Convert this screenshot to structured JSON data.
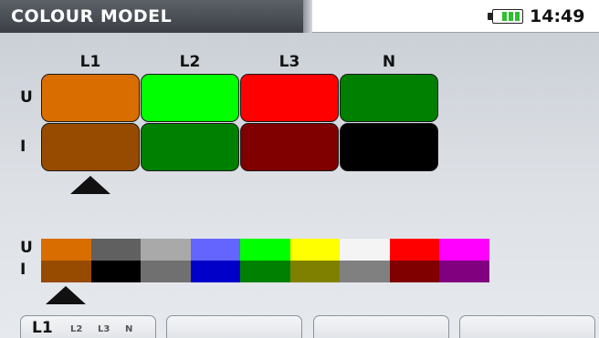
{
  "header": {
    "title": "COLOUR MODEL",
    "time": "14:49",
    "battery_level_fraction": 1.0
  },
  "matrix": {
    "columns": [
      "L1",
      "L2",
      "L3",
      "N"
    ],
    "rows": [
      "U",
      "I"
    ],
    "voltage_colors": [
      "#d96d00",
      "#00ff00",
      "#ff0000",
      "#008000"
    ],
    "current_colors": [
      "#964b00",
      "#008000",
      "#800000",
      "#000000"
    ],
    "selected_column": "L1"
  },
  "palette": {
    "row_u_label": "U",
    "row_i_label": "I",
    "voltage_colors": [
      "#d96d00",
      "#606060",
      "#a9a9a9",
      "#6464ff",
      "#00ff00",
      "#ffff00",
      "#f4f4f4",
      "#ff0000",
      "#ff00ff"
    ],
    "current_colors": [
      "#964b00",
      "#000000",
      "#707070",
      "#0000c8",
      "#008000",
      "#808000",
      "#808080",
      "#800000",
      "#800080"
    ],
    "selected_index": 0
  },
  "softkeys": {
    "key1": {
      "main": "L1",
      "options": [
        "L2",
        "L3",
        "N"
      ]
    },
    "key2": "",
    "key3": "",
    "key4": ""
  }
}
